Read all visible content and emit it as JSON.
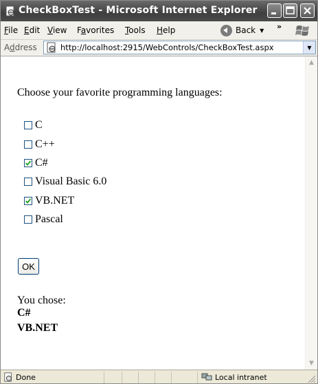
{
  "window": {
    "title": "CheckBoxTest - Microsoft Internet Explorer"
  },
  "menu": [
    {
      "pre": "",
      "accel": "F",
      "post": "ile"
    },
    {
      "pre": "",
      "accel": "E",
      "post": "dit"
    },
    {
      "pre": "",
      "accel": "V",
      "post": "iew"
    },
    {
      "pre": "F",
      "accel": "a",
      "post": "vorites"
    },
    {
      "pre": "",
      "accel": "T",
      "post": "ools"
    },
    {
      "pre": "",
      "accel": "H",
      "post": "elp"
    }
  ],
  "toolbar": {
    "back_label": "Back",
    "chevron": "»"
  },
  "address": {
    "label_pre": "A",
    "label_accel": "d",
    "label_post": "dress",
    "url": "http://localhost:2915/WebControls/CheckBoxTest.aspx"
  },
  "page": {
    "prompt": "Choose your favorite programming languages:",
    "options": [
      {
        "label": "C",
        "checked": false
      },
      {
        "label": "C++",
        "checked": false
      },
      {
        "label": "C#",
        "checked": true
      },
      {
        "label": "Visual Basic 6.0",
        "checked": false
      },
      {
        "label": "VB.NET",
        "checked": true
      },
      {
        "label": "Pascal",
        "checked": false
      }
    ],
    "ok_label": "OK",
    "result_label": "You chose:",
    "results": [
      "C#",
      "VB.NET"
    ]
  },
  "status": {
    "text": "Done",
    "zone": "Local intranet"
  },
  "icons": {
    "app": "ie-page-icon",
    "back": "back-arrow-icon",
    "winlogo": "windows-logo-icon",
    "zone": "intranet-icon",
    "scroll_up": "scroll-up-arrow-icon",
    "scroll_down": "scroll-down-arrow-icon"
  }
}
